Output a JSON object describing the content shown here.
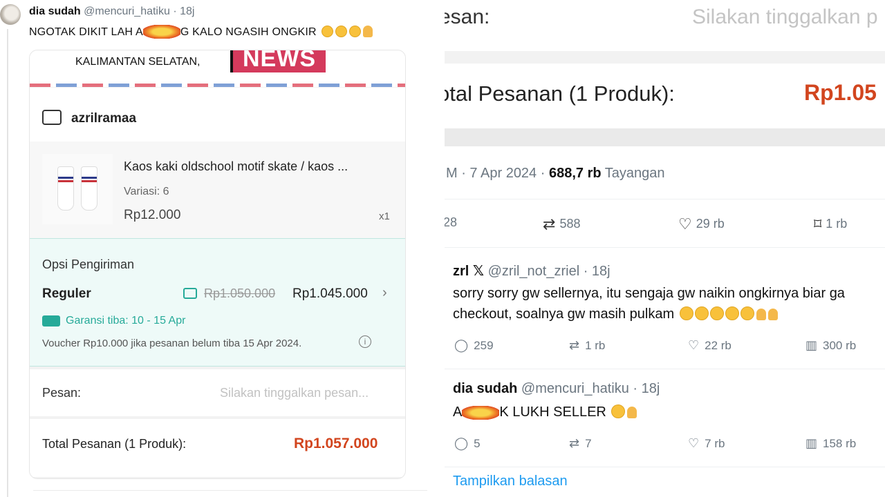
{
  "left_tweet": {
    "name": "dia sudah",
    "handle": "@mencuri_hatiku · 18j",
    "text_before": "NGOTAK DIKIT LAH A",
    "text_after": "G KALO NGASIH ONGKIR"
  },
  "checkout": {
    "address_text": "KALIMANTAN SELATAN,",
    "watermark": "NEWS",
    "shop_name": "azrilramaa",
    "product": {
      "title": "Kaos kaki oldschool motif skate / kaos ...",
      "variant": "Variasi: 6",
      "price": "Rp12.000",
      "qty": "x1"
    },
    "shipping": {
      "title": "Opsi Pengiriman",
      "type": "Reguler",
      "old_price": "Rp1.050.000",
      "new_price": "Rp1.045.000",
      "guarantee": "Garansi tiba: 10 - 15 Apr",
      "voucher": "Voucher Rp10.000 jika pesanan belum tiba 15 Apr 2024."
    },
    "message_label": "Pesan:",
    "message_placeholder": "Silakan tinggalkan pesan...",
    "total_label": "Total Pesanan (1 Produk):",
    "total_value": "Rp1.057.000"
  },
  "right": {
    "pesan_label": "esan:",
    "pesan_placeholder": "Silakan tinggalkan p",
    "total_label": "otal Pesanan (1 Produk):",
    "total_value": "Rp1.05",
    "meta_time": "M · 7 Apr 2024 · ",
    "meta_views": "688,7 rb",
    "meta_views_label": " Tayangan",
    "stats": {
      "replies": "28",
      "reposts": "588",
      "likes": "29 rb",
      "bookmarks": "1 rb"
    },
    "reply1": {
      "name": "zrl 𝕏",
      "handle": "@zril_not_zriel · 18j",
      "line1": "sorry sorry gw sellernya, itu sengaja gw naikin ongkirnya biar ga",
      "line2": "checkout, soalnya gw masih pulkam",
      "replies": "259",
      "reposts": "1 rb",
      "likes": "22 rb",
      "views": "300 rb"
    },
    "reply2": {
      "name": "dia sudah",
      "handle": "@mencuri_hatiku · 18j",
      "text_before": "A",
      "text_after": "K LUKH SELLER",
      "replies": "5",
      "reposts": "7",
      "likes": "7 rb",
      "views": "158 rb"
    },
    "show_replies": "Tampilkan balasan"
  }
}
